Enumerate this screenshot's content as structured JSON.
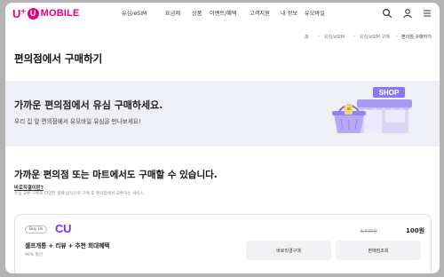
{
  "header": {
    "logo": {
      "prefix": "U",
      "plus": "+",
      "circle": "U",
      "text": "MOBILE",
      "brand_color": "#e6007e"
    },
    "nav": [
      "유심/eSIM",
      "요금제",
      "상품",
      "이벤트/혜택",
      "고객지원",
      "내 정보",
      "유모바일"
    ],
    "icons": [
      "search-icon",
      "user-icon",
      "menu-icon"
    ]
  },
  "breadcrumb": {
    "items": [
      "홈",
      "유심/eSIM",
      "유심/eSIM 구매",
      "편의점 구매하기"
    ]
  },
  "page_title": "편의점에서 구매하기",
  "banner": {
    "heading": "가까운 편의점에서 유심 구매하세요.",
    "subtext": "우리 집 앞 편의점에서 유모바일 유심을 만나보세요!",
    "shop_sign": "SHOP",
    "background": "#efeff6"
  },
  "section": {
    "title": "가까운 편의점 또는 마트에서도 구매할 수 있습니다.",
    "faq_question": "바로직결이란?",
    "faq_answer": "유심 교환 구매로 다양한 결제 방식으로 구매 후 편의점에서 교환하는 서비스"
  },
  "product": {
    "badge": "Buy Us",
    "brand": "CU",
    "brand_color": "#7b2ff7",
    "plan_name": "셀프개통 + 리뷰 + 추천 회대혜택",
    "plan_sub": "96% 할인",
    "original_price": "5,500원",
    "price": "100원",
    "button_primary": "바로직결구매",
    "button_secondary": "판매점조회"
  }
}
